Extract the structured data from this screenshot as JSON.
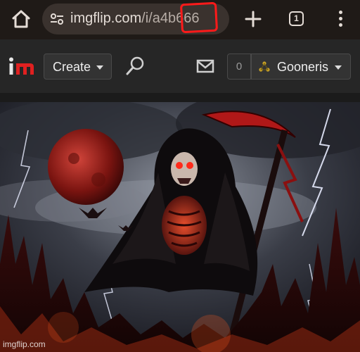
{
  "browser": {
    "url_domain": "imgflip.com",
    "url_path": "/i/a4b666",
    "tab_count": "1",
    "icons": [
      "home-icon",
      "site-info-icon",
      "plus-icon",
      "tab-switcher-icon",
      "more-vert-icon"
    ]
  },
  "nav": {
    "logo_text": "im",
    "create_label": "Create",
    "notification_count": "0",
    "username": "Gooneris",
    "icons": [
      "search-icon",
      "mail-icon",
      "caret-down-icon"
    ]
  },
  "meme": {
    "watermark": "imgflip.com"
  },
  "colors": {
    "annotation": "#ff1a1a",
    "logo_i": "#e8e8e8",
    "logo_m": "#e02020",
    "nav_bg": "#262626",
    "browser_bg": "#1f1a17"
  }
}
